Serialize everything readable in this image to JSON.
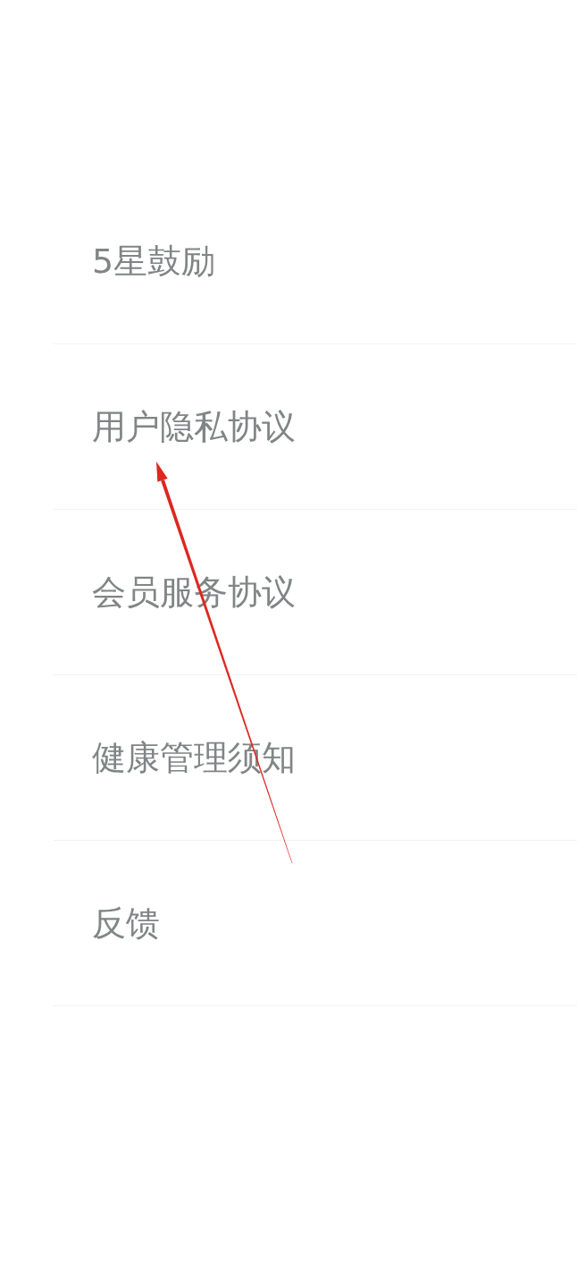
{
  "menu": {
    "items": [
      {
        "label": "5星鼓励"
      },
      {
        "label": "用户隐私协议"
      },
      {
        "label": "会员服务协议"
      },
      {
        "label": "健康管理须知"
      },
      {
        "label": "反馈"
      }
    ]
  }
}
